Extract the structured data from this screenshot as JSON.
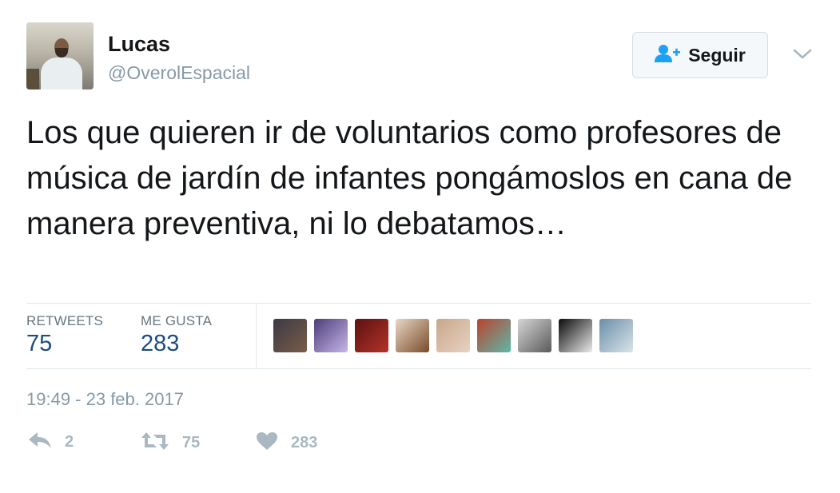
{
  "user": {
    "name": "Lucas",
    "handle": "@OverolEspacial"
  },
  "follow_button": {
    "label": "Seguir",
    "icon": "add-user-icon"
  },
  "menu_icon": "chevron-down-icon",
  "tweet": {
    "text": "Los que quieren ir de voluntarios como profesores de música de jardín de infantes pongámoslos en cana de manera preventiva, ni lo debatamos…"
  },
  "stats": {
    "retweets_label": "RETWEETS",
    "retweets_value": "75",
    "likes_label": "ME GUSTA",
    "likes_value": "283"
  },
  "likers": [
    {
      "name": "liker-avatar-1",
      "colors": [
        "#3b3a45",
        "#7a5c4a"
      ]
    },
    {
      "name": "liker-avatar-2",
      "colors": [
        "#4a3e7a",
        "#c9b5e8"
      ]
    },
    {
      "name": "liker-avatar-3",
      "colors": [
        "#5c1210",
        "#b3322a"
      ]
    },
    {
      "name": "liker-avatar-4",
      "colors": [
        "#e8d8c4",
        "#7a4a2a"
      ]
    },
    {
      "name": "liker-avatar-5",
      "colors": [
        "#c9a78a",
        "#e7d2c3"
      ]
    },
    {
      "name": "liker-avatar-6",
      "colors": [
        "#b8432d",
        "#5fb8a8"
      ]
    },
    {
      "name": "liker-avatar-7",
      "colors": [
        "#d6d6d6",
        "#5a5a5a"
      ]
    },
    {
      "name": "liker-avatar-8",
      "colors": [
        "#0a0a0a",
        "#eaeaea"
      ]
    },
    {
      "name": "liker-avatar-9",
      "colors": [
        "#6b8ea8",
        "#d9e4ea"
      ]
    }
  ],
  "timestamp": "19:49 - 23 feb. 2017",
  "actions": {
    "reply_count": "2",
    "retweet_count": "75",
    "like_count": "283"
  },
  "colors": {
    "link_blue": "#1c4b80",
    "muted": "#8899a6",
    "action_gray": "#aab8c2",
    "follow_icon_blue": "#1da1f2"
  }
}
